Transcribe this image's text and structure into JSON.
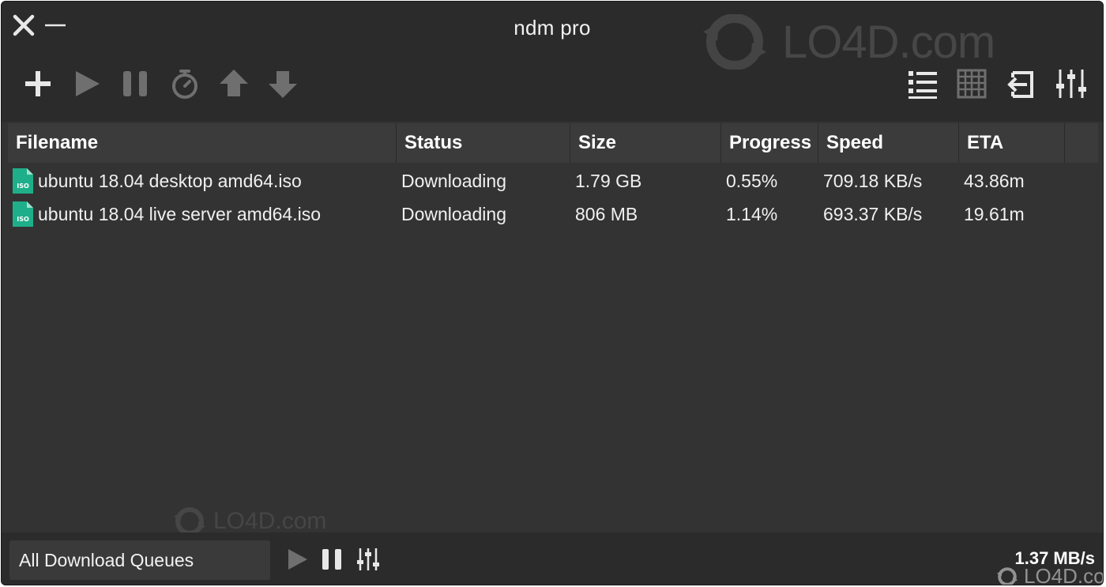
{
  "window": {
    "title": "ndm pro"
  },
  "watermark": {
    "text": ".com",
    "brand": "LO4D"
  },
  "toolbar": {
    "left": [
      {
        "name": "add-icon"
      },
      {
        "name": "play-icon"
      },
      {
        "name": "pause-icon"
      },
      {
        "name": "timer-icon"
      },
      {
        "name": "move-up-icon"
      },
      {
        "name": "move-down-icon"
      }
    ],
    "right": [
      {
        "name": "list-view-icon"
      },
      {
        "name": "grid-view-icon"
      },
      {
        "name": "import-icon"
      },
      {
        "name": "settings-sliders-icon"
      }
    ]
  },
  "table": {
    "columns": [
      "Filename",
      "Status",
      "Size",
      "Progress",
      "Speed",
      "ETA"
    ],
    "rows": [
      {
        "icon_label": "ISO",
        "filename": "ubuntu 18.04 desktop amd64.iso",
        "status": "Downloading",
        "size": "1.79 GB",
        "progress": "0.55%",
        "speed": "709.18 KB/s",
        "eta": "43.86m"
      },
      {
        "icon_label": "ISO",
        "filename": "ubuntu 18.04 live server amd64.iso",
        "status": "Downloading",
        "size": "806 MB",
        "progress": "1.14%",
        "speed": "693.37 KB/s",
        "eta": "19.61m"
      }
    ]
  },
  "footer": {
    "queue_selected": "All Download Queues",
    "total_speed": "1.37 MB/s"
  },
  "colors": {
    "window_bg": "#333333",
    "titlebar_bg": "#2b2b2b",
    "header_bg": "#3b3b3b",
    "file_icon": "#1fae8a",
    "icon_active": "#e8e8e8",
    "icon_disabled": "#6f6f6f"
  }
}
